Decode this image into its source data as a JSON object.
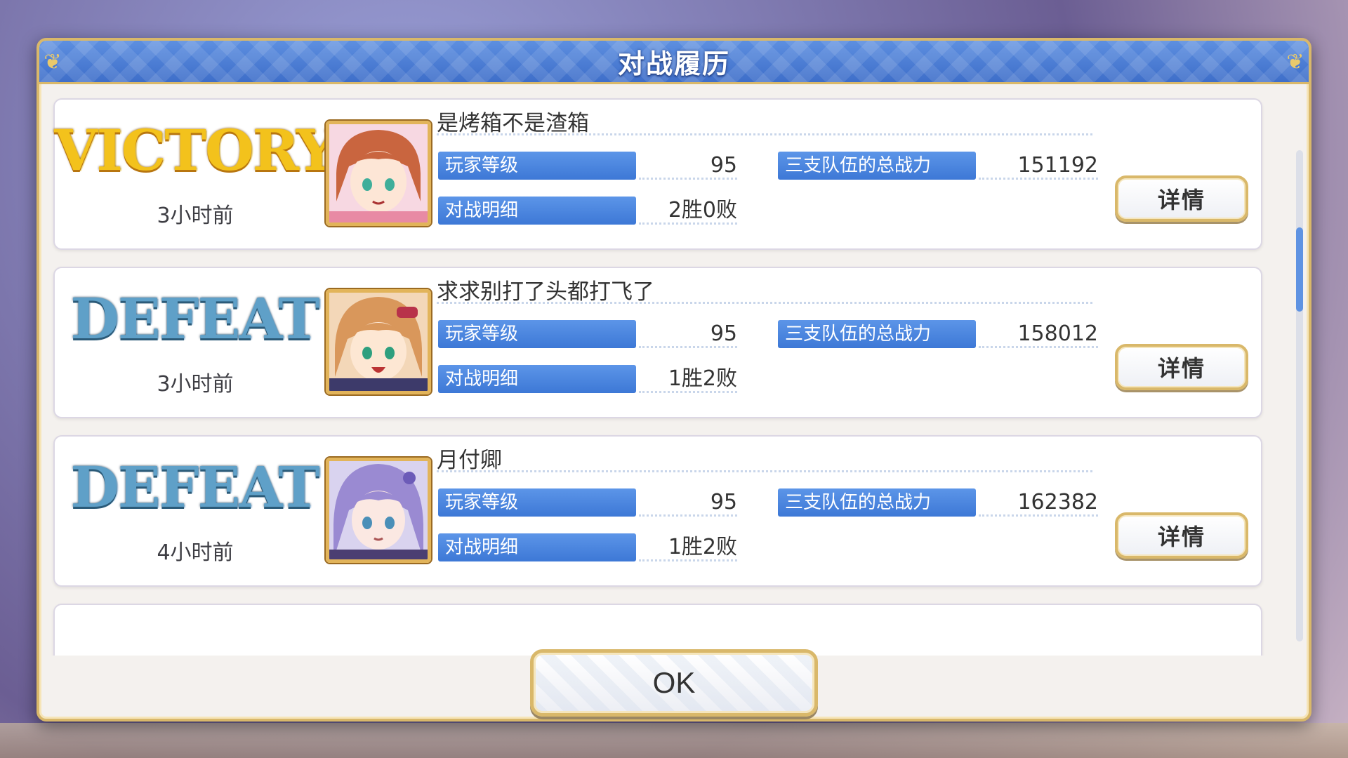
{
  "dialog": {
    "title": "对战履历",
    "ok_label": "OK"
  },
  "records": [
    {
      "result": "VICTORY",
      "time_ago": "3小时前",
      "player_name": "是烤箱不是渣箱",
      "level_label": "玩家等级",
      "level_value": "95",
      "power_label": "三支队伍的总战力",
      "power_value": "151192",
      "battle_label": "对战明细",
      "battle_value": "2胜0败",
      "detail_label": "详情"
    },
    {
      "result": "DEFEAT",
      "time_ago": "3小时前",
      "player_name": "求求别打了头都打飞了",
      "level_label": "玩家等级",
      "level_value": "95",
      "power_label": "三支队伍的总战力",
      "power_value": "158012",
      "battle_label": "对战明细",
      "battle_value": "1胜2败",
      "detail_label": "详情"
    },
    {
      "result": "DEFEAT",
      "time_ago": "4小时前",
      "player_name": "月付卿",
      "level_label": "玩家等级",
      "level_value": "95",
      "power_label": "三支队伍的总战力",
      "power_value": "162382",
      "battle_label": "对战明细",
      "battle_value": "1胜2败",
      "detail_label": "详情"
    }
  ],
  "colors": {
    "victory": "#f3c21c",
    "defeat": "#5fa0c8",
    "tag_blue": "#4a85dd",
    "frame_gold": "#d9b86a"
  },
  "icons": [
    "portrait-avatar-1",
    "portrait-avatar-2",
    "portrait-avatar-3"
  ]
}
